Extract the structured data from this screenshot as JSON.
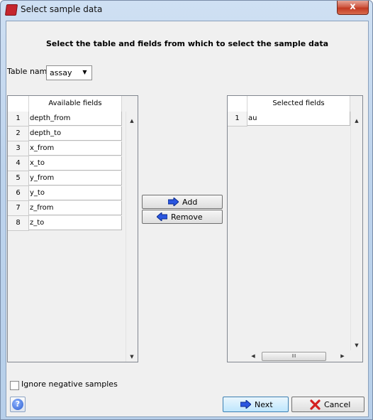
{
  "window": {
    "title": "Select sample data",
    "close_label": "x"
  },
  "heading": "Select the table and fields from which to select the sample data",
  "table_name": {
    "label": "Table name",
    "value": "assay"
  },
  "available": {
    "header": "Available fields",
    "rows": [
      {
        "num": "1",
        "field": "depth_from"
      },
      {
        "num": "2",
        "field": "depth_to"
      },
      {
        "num": "3",
        "field": "x_from"
      },
      {
        "num": "4",
        "field": "x_to"
      },
      {
        "num": "5",
        "field": "y_from"
      },
      {
        "num": "6",
        "field": "y_to"
      },
      {
        "num": "7",
        "field": "z_from"
      },
      {
        "num": "8",
        "field": "z_to"
      }
    ]
  },
  "selected": {
    "header": "Selected fields",
    "rows": [
      {
        "num": "1",
        "field": "au"
      }
    ],
    "hscroll_grip": "III"
  },
  "buttons": {
    "add": "Add",
    "remove": "Remove",
    "next": "Next",
    "cancel": "Cancel"
  },
  "ignore_negative": {
    "label": "Ignore negative samples",
    "checked": false
  },
  "colors": {
    "accent": "#1f4fd6",
    "cancel": "#d42020"
  }
}
